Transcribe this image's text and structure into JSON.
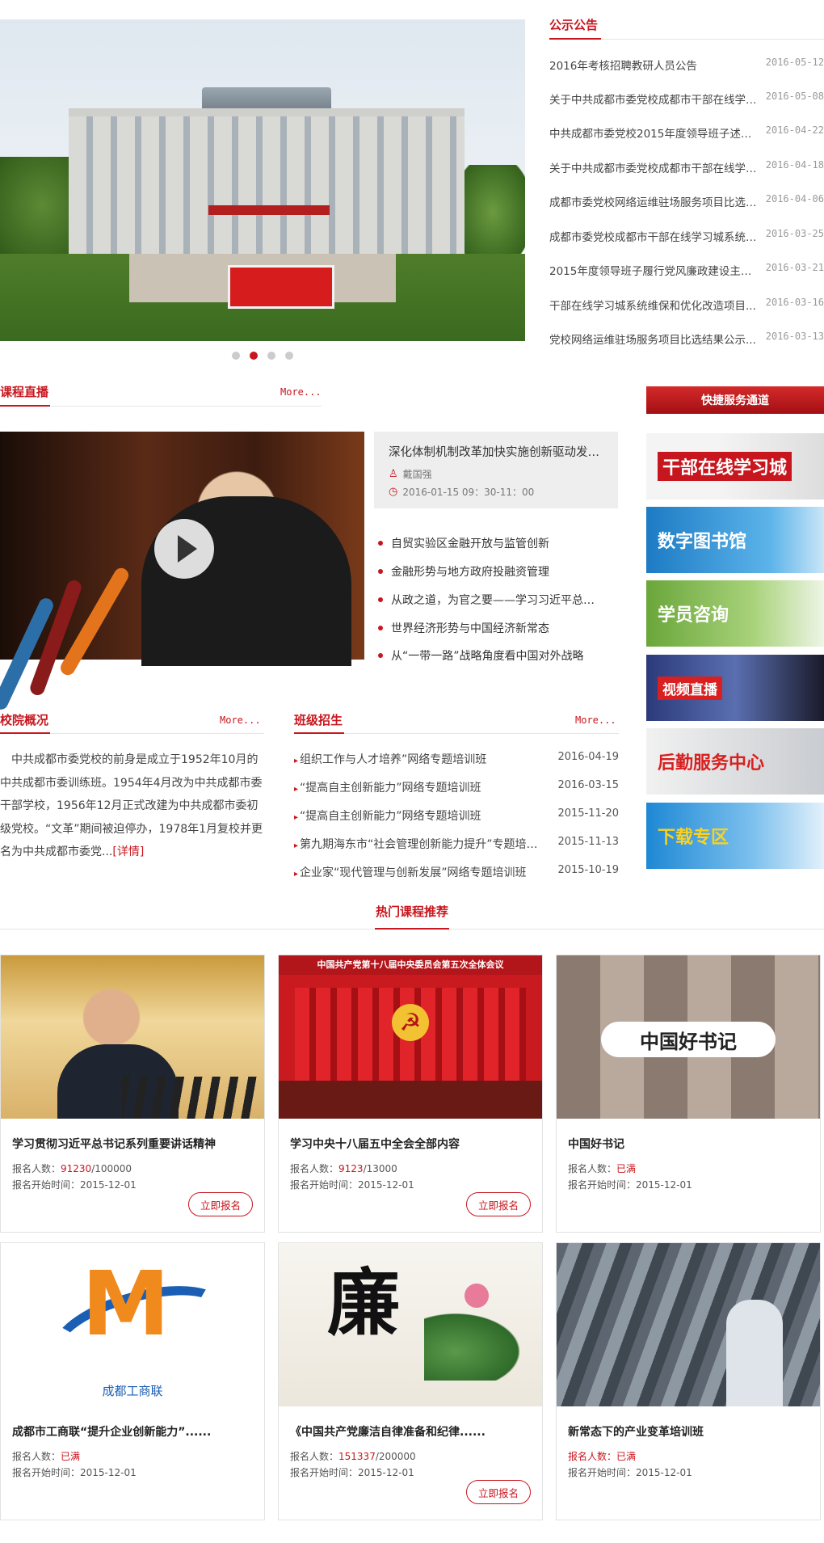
{
  "notice": {
    "title": "公示公告",
    "items": [
      {
        "title": "2016年考核招聘教研人员公告",
        "date": "2016-05-12"
      },
      {
        "title": "关于中共成都市委党校成都市干部在线学习城...",
        "date": "2016-05-08"
      },
      {
        "title": "中共成都市委党校2015年度领导班子述职述廉...",
        "date": "2016-04-22"
      },
      {
        "title": "关于中共成都市委党校成都市干部在线学习城...",
        "date": "2016-04-18"
      },
      {
        "title": "成都市委党校网络运维驻场服务项目比选公告...",
        "date": "2016-04-06"
      },
      {
        "title": "成都市委党校成都市干部在线学习城系统维保...",
        "date": "2016-03-25"
      },
      {
        "title": "2015年度领导班子履行党风廉政建设主体责任...",
        "date": "2016-03-21"
      },
      {
        "title": "干部在线学习城系统维保和优化改造项目...",
        "date": "2016-03-16"
      },
      {
        "title": "党校网络运维驻场服务项目比选结果公示...",
        "date": "2016-03-13"
      }
    ]
  },
  "live": {
    "title": "课程直播",
    "more": "More...",
    "featured": {
      "title": "深化体制机制改革加快实施创新驱动发展战略",
      "speaker": "戴国强",
      "time": "2016-01-15  09：30-11：00"
    },
    "items": [
      "自贸实验区金融开放与监管创新",
      "金融形势与地方政府投融资管理",
      "从政之道，为官之要——学习习近平总书记系列重要讲话",
      "世界经济形势与中国经济新常态",
      "从“一带一路”战略角度看中国对外战略"
    ]
  },
  "quick_service": {
    "title": "快捷服务通道",
    "items": [
      {
        "label": "干部在线学习城",
        "color": "#c8161e"
      },
      {
        "label": "数字图书馆",
        "color": "#1c7bc4"
      },
      {
        "label": "学员咨询",
        "color": "#6aa63a"
      },
      {
        "label": "视频直播",
        "color": "#2c3a7a"
      },
      {
        "label": "后勤服务中心",
        "color": "#d91f1f"
      },
      {
        "label": "下载专区",
        "color": "#1e88d4"
      }
    ]
  },
  "overview": {
    "title": "校院概况",
    "more": "More...",
    "text": "中共成都市委党校的前身是成立于1952年10月的中共成都市委训练班。1954年4月改为中共成都市委干部学校，1956年12月正式改建为中共成都市委初级党校。“文革”期间被迫停办，1978年1月复校并更名为中共成都市委党...",
    "detail": "[详情]"
  },
  "classes": {
    "title": "班级招生",
    "more": "More...",
    "items": [
      {
        "title": "组织工作与人才培养”网络专题培训班",
        "date": "2016-04-19"
      },
      {
        "title": "“提高自主创新能力”网络专题培训班",
        "date": "2016-03-15"
      },
      {
        "title": "“提高自主创新能力”网络专题培训班",
        "date": "2015-11-20"
      },
      {
        "title": "第九期海东市“社会管理创新能力提升”专题培训班",
        "date": "2015-11-13"
      },
      {
        "title": "企业家“现代管理与创新发展”网络专题培训班",
        "date": "2015-10-19"
      }
    ]
  },
  "hot": {
    "title": "热门课程推荐",
    "count_label": "报名人数：",
    "start_label": "报名开始时间：",
    "button": "立即报名",
    "cards": [
      {
        "title": "学习贯彻习近平总书记系列重要讲话精神",
        "count": "91230",
        "total": "/100000",
        "start": "2015-12-01",
        "button": true
      },
      {
        "title": "学习中央十八届五中全会全部内容",
        "count": "9123",
        "total": "/13000",
        "start": "2015-12-01",
        "button": true,
        "banner": "中国共产党第十八届中央委员会第五次全体会议"
      },
      {
        "title": "中国好书记",
        "count": "已满",
        "total": "",
        "start": "2015-12-01",
        "button": false,
        "banner": "中国好书记"
      },
      {
        "title": "成都市工商联“提升企业创新能力”......",
        "count": "已满",
        "total": "",
        "start": "2015-12-01",
        "button": false,
        "banner": "成都工商联"
      },
      {
        "title": "《中国共产党廉洁自律准备和纪律......",
        "count": "151337",
        "total": "/200000",
        "start": "2015-12-01",
        "button": true,
        "banner": "廉"
      },
      {
        "title": "新常态下的产业变革培训班",
        "count": "已满",
        "total": "",
        "start": "2015-12-01",
        "button": false
      }
    ]
  }
}
